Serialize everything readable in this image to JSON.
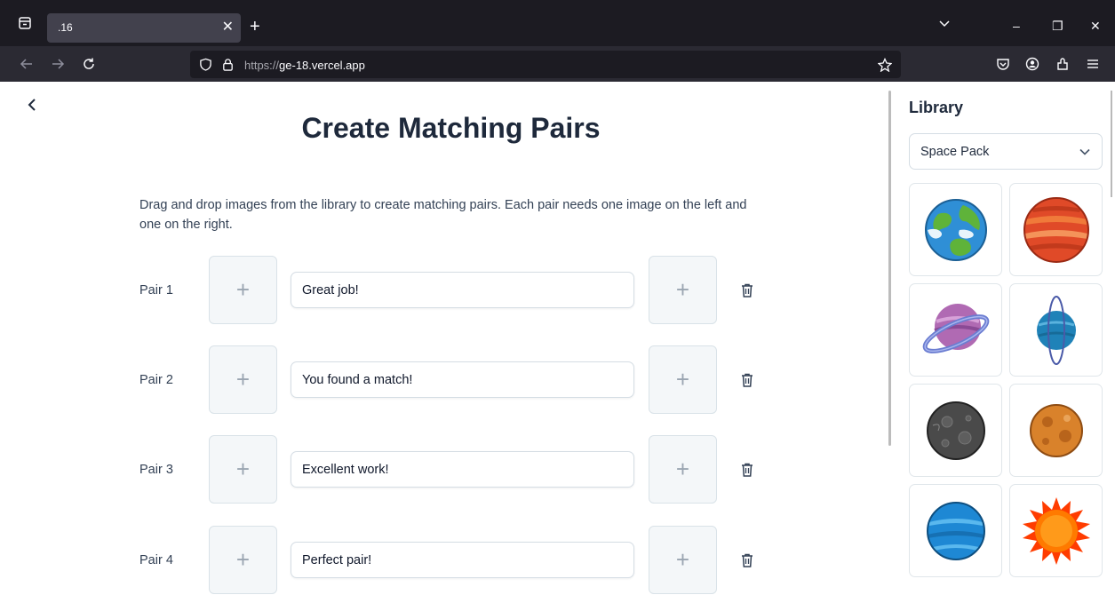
{
  "browser": {
    "tab_title": ".16",
    "url_scheme": "https://",
    "url_host": "ge-18.vercel.app"
  },
  "page": {
    "title": "Create Matching Pairs",
    "instructions": "Drag and drop images from the library to create matching pairs. Each pair needs one image on the left and one on the right.",
    "pairs": [
      {
        "label": "Pair 1",
        "message": "Great job!"
      },
      {
        "label": "Pair 2",
        "message": "You found a match!"
      },
      {
        "label": "Pair 3",
        "message": "Excellent work!"
      },
      {
        "label": "Pair 4",
        "message": "Perfect pair!"
      }
    ]
  },
  "library": {
    "title": "Library",
    "selected_pack": "Space Pack",
    "items": [
      {
        "name": "earth-planet-image",
        "color": "#2f8fd6"
      },
      {
        "name": "red-gas-giant-image",
        "color": "#e04a28"
      },
      {
        "name": "purple-ringed-planet-image",
        "color": "#b06ab3"
      },
      {
        "name": "blue-ringed-planet-image",
        "color": "#1f82b8"
      },
      {
        "name": "grey-cratered-planet-image",
        "color": "#4a4a4a"
      },
      {
        "name": "orange-cratered-planet-image",
        "color": "#d9822b"
      },
      {
        "name": "blue-striped-planet-image",
        "color": "#1e88d4"
      },
      {
        "name": "sun-image",
        "color": "#ff6a00"
      }
    ]
  }
}
